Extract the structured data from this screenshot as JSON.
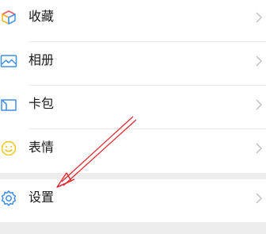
{
  "menu": {
    "items": [
      {
        "label": "收藏",
        "icon": "cube-favorites-icon"
      },
      {
        "label": "相册",
        "icon": "photo-album-icon"
      },
      {
        "label": "卡包",
        "icon": "card-wallet-icon"
      },
      {
        "label": "表情",
        "icon": "smiley-face-icon"
      }
    ],
    "settings": {
      "label": "设置",
      "icon": "gear-settings-icon"
    }
  },
  "colors": {
    "accent_blue": "#3d8ee8",
    "favorites_red": "#ea5a5a",
    "favorites_yellow": "#f5b82e",
    "favorites_blue": "#4a9ae8",
    "emoji_yellow": "#f0c419",
    "annotation_red": "#e0262b",
    "background": "#ededed"
  }
}
